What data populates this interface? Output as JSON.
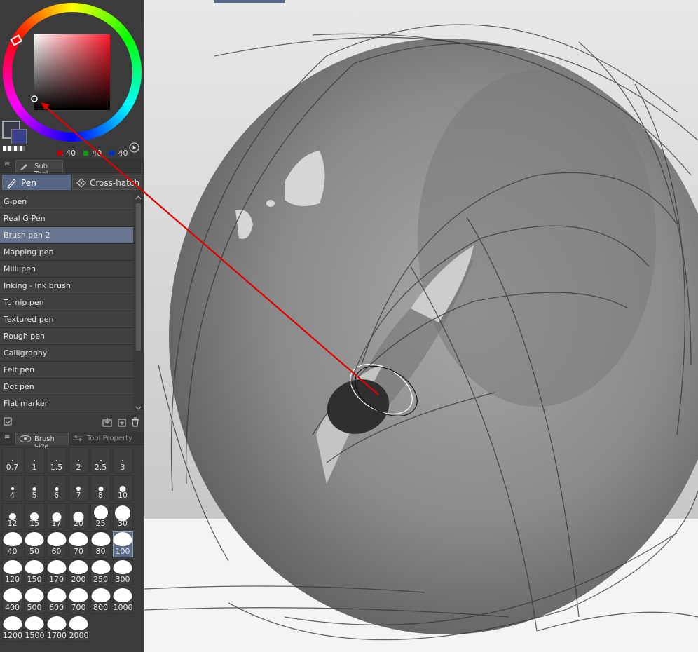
{
  "color_panel": {
    "rgb": [
      {
        "color": "#c00000",
        "value": "40"
      },
      {
        "color": "#00a000",
        "value": "40"
      },
      {
        "color": "#0030c0",
        "value": "40"
      }
    ]
  },
  "subtool": {
    "header": "Sub Tool",
    "tabs": [
      "Pen",
      "Cross-hatch Pe"
    ],
    "items": [
      "G-pen",
      "Real G-Pen",
      "Brush pen 2",
      "Mapping pen",
      "Milli pen",
      "Inking - Ink brush",
      "Turnip pen",
      "Textured pen",
      "Rough pen",
      "Calligraphy",
      "Felt pen",
      "Dot pen",
      "Flat marker"
    ],
    "selected": "Brush pen 2"
  },
  "brush_size": {
    "tabs": [
      "Brush Size",
      "Tool Property"
    ],
    "sizes": [
      "0.7",
      "1",
      "1.5",
      "2",
      "2.5",
      "3",
      "4",
      "5",
      "6",
      "7",
      "8",
      "10",
      "12",
      "15",
      "17",
      "20",
      "25",
      "30",
      "40",
      "50",
      "60",
      "70",
      "80",
      "100",
      "120",
      "150",
      "170",
      "200",
      "250",
      "300",
      "400",
      "500",
      "600",
      "700",
      "800",
      "1000",
      "1200",
      "1500",
      "1700",
      "2000"
    ],
    "selected": "100"
  },
  "colors": {
    "accent": "#566682",
    "selection": "#6a7590",
    "annotation": "#e00000"
  }
}
